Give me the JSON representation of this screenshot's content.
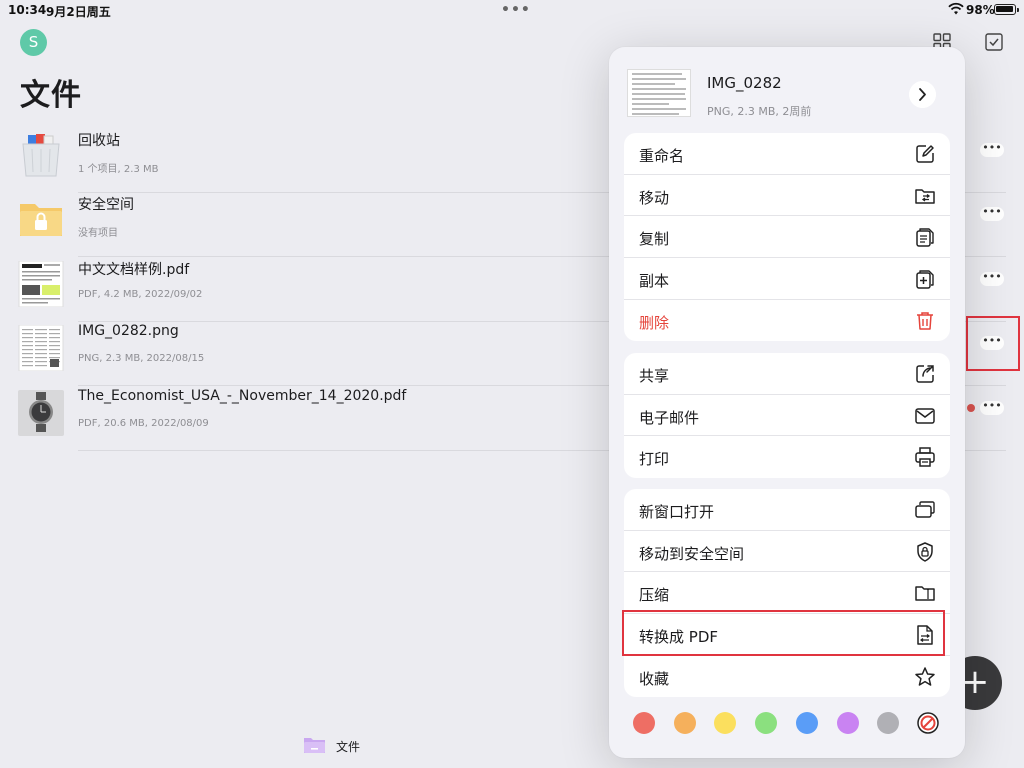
{
  "status_bar": {
    "time": "10:34",
    "date": "9月2日周五",
    "battery": "98%"
  },
  "avatar_letter": "S",
  "page_title": "文件",
  "files": [
    {
      "name": "回收站",
      "meta": "1 个项目, 2.3 MB",
      "icon": "trash-icon"
    },
    {
      "name": "安全空间",
      "meta": "没有项目",
      "icon": "lock-folder-icon"
    },
    {
      "name": "中文文档样例.pdf",
      "meta": "PDF, 4.2 MB, 2022/09/02",
      "icon": "pdf-thumbnail"
    },
    {
      "name": "IMG_0282.png",
      "meta": "PNG, 2.3 MB, 2022/08/15",
      "icon": "image-thumbnail"
    },
    {
      "name": "The_Economist_USA_-_November_14_2020.pdf",
      "meta": "PDF, 20.6 MB, 2022/08/09",
      "icon": "watch-thumbnail"
    }
  ],
  "menu": {
    "header": {
      "title": "IMG_0282",
      "meta": "PNG, 2.3 MB, 2周前"
    },
    "group1": [
      {
        "label": "重命名",
        "icon": "edit-icon"
      },
      {
        "label": "移动",
        "icon": "move-folder-icon"
      },
      {
        "label": "复制",
        "icon": "copy-icon"
      },
      {
        "label": "副本",
        "icon": "duplicate-icon"
      },
      {
        "label": "删除",
        "icon": "trash-icon",
        "danger": true
      }
    ],
    "group2": [
      {
        "label": "共享",
        "icon": "share-icon"
      },
      {
        "label": "电子邮件",
        "icon": "mail-icon"
      },
      {
        "label": "打印",
        "icon": "printer-icon"
      }
    ],
    "group3": [
      {
        "label": "新窗口打开",
        "icon": "new-window-icon"
      },
      {
        "label": "移动到安全空间",
        "icon": "shield-lock-icon"
      },
      {
        "label": "压缩",
        "icon": "zip-folder-icon"
      },
      {
        "label": "转换成 PDF",
        "icon": "convert-pdf-icon"
      },
      {
        "label": "收藏",
        "icon": "star-icon"
      }
    ],
    "colors": [
      "#ee6e64",
      "#f5b05c",
      "#fbdf5e",
      "#8be07f",
      "#5a9df7",
      "#c983f2",
      "#b0b0b5"
    ]
  },
  "bottom_tab": {
    "label": "文件"
  }
}
